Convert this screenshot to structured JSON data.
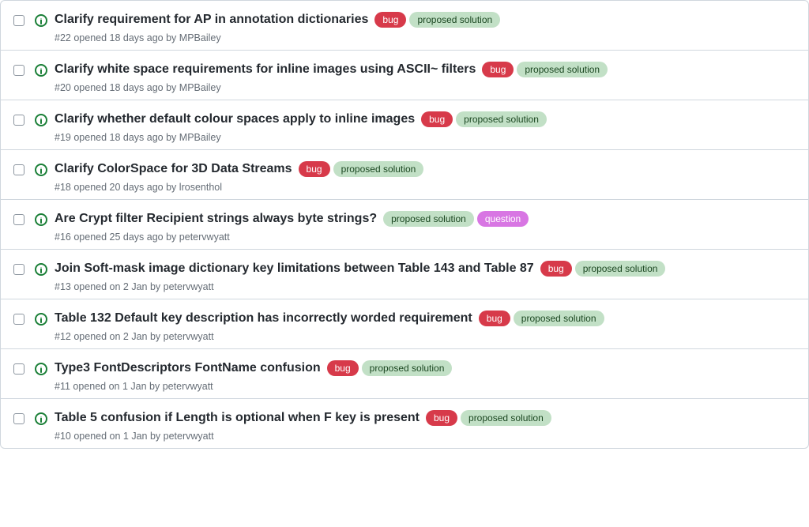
{
  "label_colors": {
    "bug": {
      "bg": "#d73a4a",
      "fg": "#ffffff"
    },
    "proposed solution": {
      "bg": "#c2e0c6",
      "fg": "#1b4721"
    },
    "question": {
      "bg": "#d876e3",
      "fg": "#ffffff"
    }
  },
  "issues": [
    {
      "title": "Clarify requirement for AP in annotation dictionaries",
      "labels": [
        "bug",
        "proposed solution"
      ],
      "number": "#22",
      "opened": "opened 18 days ago by",
      "author": "MPBailey"
    },
    {
      "title": "Clarify white space requirements for inline images using ASCII~ filters",
      "labels": [
        "bug",
        "proposed solution"
      ],
      "number": "#20",
      "opened": "opened 18 days ago by",
      "author": "MPBailey"
    },
    {
      "title": "Clarify whether default colour spaces apply to inline images",
      "labels": [
        "bug",
        "proposed solution"
      ],
      "number": "#19",
      "opened": "opened 18 days ago by",
      "author": "MPBailey"
    },
    {
      "title": "Clarify ColorSpace for 3D Data Streams",
      "labels": [
        "bug",
        "proposed solution"
      ],
      "number": "#18",
      "opened": "opened 20 days ago by",
      "author": "lrosenthol"
    },
    {
      "title": "Are Crypt filter Recipient strings always byte strings?",
      "labels": [
        "proposed solution",
        "question"
      ],
      "number": "#16",
      "opened": "opened 25 days ago by",
      "author": "petervwyatt"
    },
    {
      "title": "Join Soft-mask image dictionary key limitations between Table 143 and Table 87",
      "labels": [
        "bug",
        "proposed solution"
      ],
      "number": "#13",
      "opened": "opened on 2 Jan by",
      "author": "petervwyatt"
    },
    {
      "title": "Table 132 Default key description has incorrectly worded requirement",
      "labels": [
        "bug",
        "proposed solution"
      ],
      "number": "#12",
      "opened": "opened on 2 Jan by",
      "author": "petervwyatt"
    },
    {
      "title": "Type3 FontDescriptors FontName confusion",
      "labels": [
        "bug",
        "proposed solution"
      ],
      "number": "#11",
      "opened": "opened on 1 Jan by",
      "author": "petervwyatt"
    },
    {
      "title": "Table 5 confusion if Length is optional when F key is present",
      "labels": [
        "bug",
        "proposed solution"
      ],
      "number": "#10",
      "opened": "opened on 1 Jan by",
      "author": "petervwyatt"
    }
  ]
}
